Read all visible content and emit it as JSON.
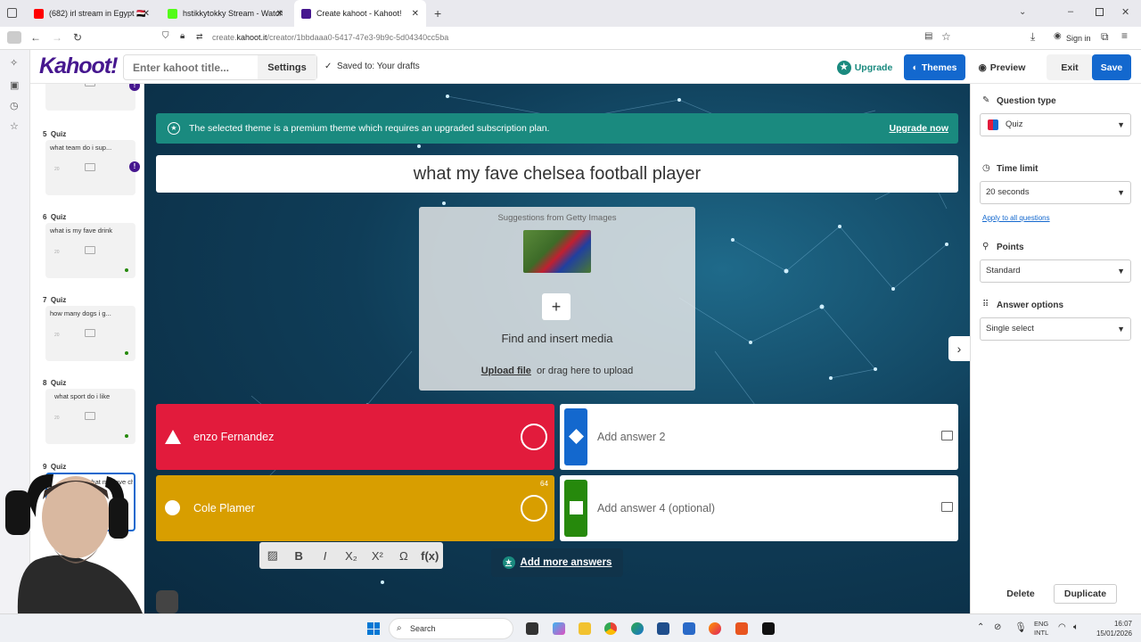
{
  "browser": {
    "tabs": [
      {
        "title": "(682) irl stream in Egypt 🇪🇬",
        "color": "#ff0000",
        "active": false
      },
      {
        "title": "hstikkytokky Stream - Watch Li",
        "color": "#53fc18",
        "active": false
      },
      {
        "title": "Create kahoot - Kahoot!",
        "color": "#46178f",
        "active": true
      }
    ],
    "url_prefix": "create.",
    "url_domain": "kahoot.it",
    "url_path": "/creator/1bbdaaa0-5417-47e3-9b9c-5d04340cc5ba",
    "sign_in": "Sign in"
  },
  "header": {
    "logo": "Kahoot!",
    "title_placeholder": "Enter kahoot title...",
    "settings": "Settings",
    "saved": "Saved to: Your drafts",
    "upgrade": "Upgrade",
    "themes": "Themes",
    "preview": "Preview",
    "exit": "Exit",
    "save": "Save"
  },
  "slides": [
    {
      "num": "5",
      "type": "Quiz",
      "question": "what team do i sup...",
      "time": "20",
      "warning": true
    },
    {
      "num": "6",
      "type": "Quiz",
      "question": "what is my fave drink",
      "time": "20",
      "warning": false
    },
    {
      "num": "7",
      "type": "Quiz",
      "question": "how many dogs i g...",
      "time": "20",
      "warning": false
    },
    {
      "num": "8",
      "type": "Quiz",
      "question": "what sport do i like",
      "time": "20",
      "warning": false
    },
    {
      "num": "9",
      "type": "Quiz",
      "question": "what my fave chels...",
      "time": "20",
      "warning": false
    }
  ],
  "editor": {
    "banner_text": "The selected theme is a premium theme which requires an upgraded subscription plan.",
    "banner_link": "Upgrade now",
    "question": "what my fave chelsea football player",
    "media_suggest": "Suggestions from Getty Images",
    "media_title": "Find and insert media",
    "upload_link": "Upload file",
    "upload_rest": "or drag here to upload",
    "answers": [
      {
        "text": "enzo Fernandez",
        "color": "#e21b3c",
        "shape": "triangle",
        "filled": true
      },
      {
        "text": "Add answer 2",
        "color": "#1368ce",
        "shape": "diamond",
        "filled": false
      },
      {
        "text": "Cole Plamer",
        "color": "#d89e00",
        "shape": "circle",
        "filled": true
      },
      {
        "text": "Add answer 4 (optional)",
        "color": "#26890c",
        "shape": "square",
        "filled": false
      }
    ],
    "cursor_badge": "64",
    "format_tools": [
      "B",
      "I",
      "X₂",
      "X²",
      "Ω",
      "f(x)"
    ],
    "add_more": "Add more answers"
  },
  "panel": {
    "question_type_label": "Question type",
    "question_type": "Quiz",
    "time_limit_label": "Time limit",
    "time_limit": "20 seconds",
    "apply_all": "Apply to all questions",
    "points_label": "Points",
    "points": "Standard",
    "answer_options_label": "Answer options",
    "answer_options": "Single select",
    "delete": "Delete",
    "duplicate": "Duplicate"
  },
  "taskbar": {
    "search": "Search",
    "lang": "ENG",
    "lang2": "INTL",
    "time": "16:07",
    "date": "15/01/2026"
  }
}
